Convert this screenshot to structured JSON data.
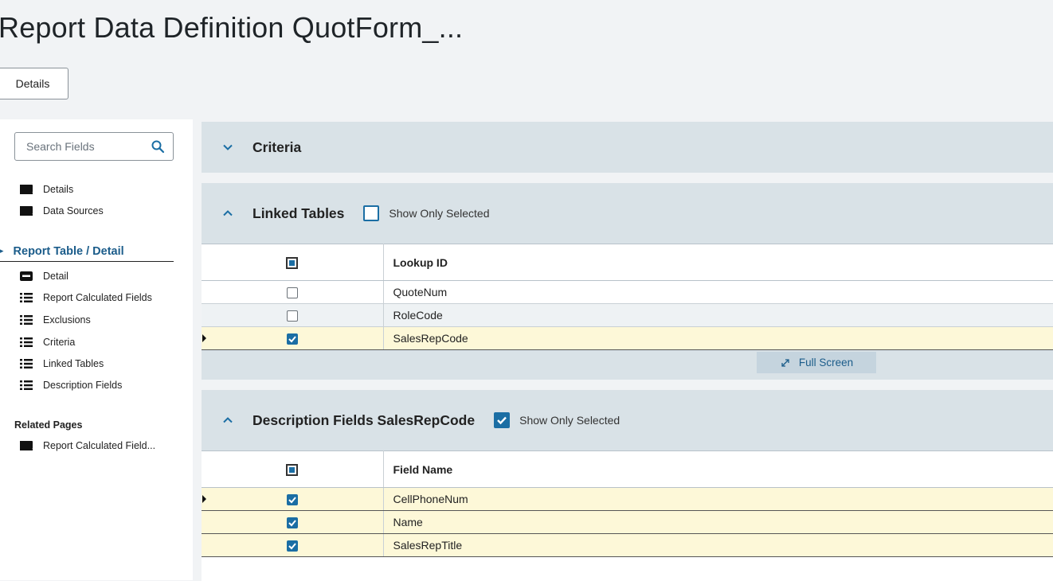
{
  "page": {
    "title": "Report Data Definition QuotForm_...",
    "details_button": "Details"
  },
  "sidebar": {
    "search_placeholder": "Search Fields",
    "top_items": [
      {
        "label": "Details",
        "icon": "book-icon"
      },
      {
        "label": "Data Sources",
        "icon": "book-icon"
      }
    ],
    "section_title": "Report Table / Detail",
    "section_items": [
      {
        "label": "Detail",
        "icon": "form-icon"
      },
      {
        "label": "Report Calculated Fields",
        "icon": "list-icon"
      },
      {
        "label": "Exclusions",
        "icon": "list-icon"
      },
      {
        "label": "Criteria",
        "icon": "list-icon"
      },
      {
        "label": "Linked Tables",
        "icon": "list-icon"
      },
      {
        "label": "Description Fields",
        "icon": "list-icon"
      }
    ],
    "related_title": "Related Pages",
    "related_items": [
      {
        "label": "Report Calculated Field...",
        "icon": "book-icon"
      }
    ]
  },
  "criteria_panel": {
    "title": "Criteria",
    "expanded": false
  },
  "linked_tables_panel": {
    "title": "Linked Tables",
    "show_only_selected_label": "Show Only Selected",
    "show_only_selected": false,
    "column_header": "Lookup ID",
    "rows": [
      {
        "value": "QuoteNum",
        "checked": false,
        "selected": false
      },
      {
        "value": "RoleCode",
        "checked": false,
        "selected": false
      },
      {
        "value": "SalesRepCode",
        "checked": true,
        "selected": true
      }
    ],
    "full_screen_label": "Full Screen"
  },
  "description_panel": {
    "title": "Description Fields SalesRepCode",
    "show_only_selected_label": "Show Only Selected",
    "show_only_selected": true,
    "column_header": "Field Name",
    "rows": [
      {
        "value": "CellPhoneNum",
        "checked": true,
        "selected": true
      },
      {
        "value": "Name",
        "checked": true,
        "selected": true
      },
      {
        "value": "SalesRepTitle",
        "checked": true,
        "selected": true
      }
    ]
  },
  "colors": {
    "accent": "#1b6ea4",
    "panel_bg": "#d9e2e7",
    "selected_row": "#fdf8d8",
    "link": "#1b5c8a"
  }
}
